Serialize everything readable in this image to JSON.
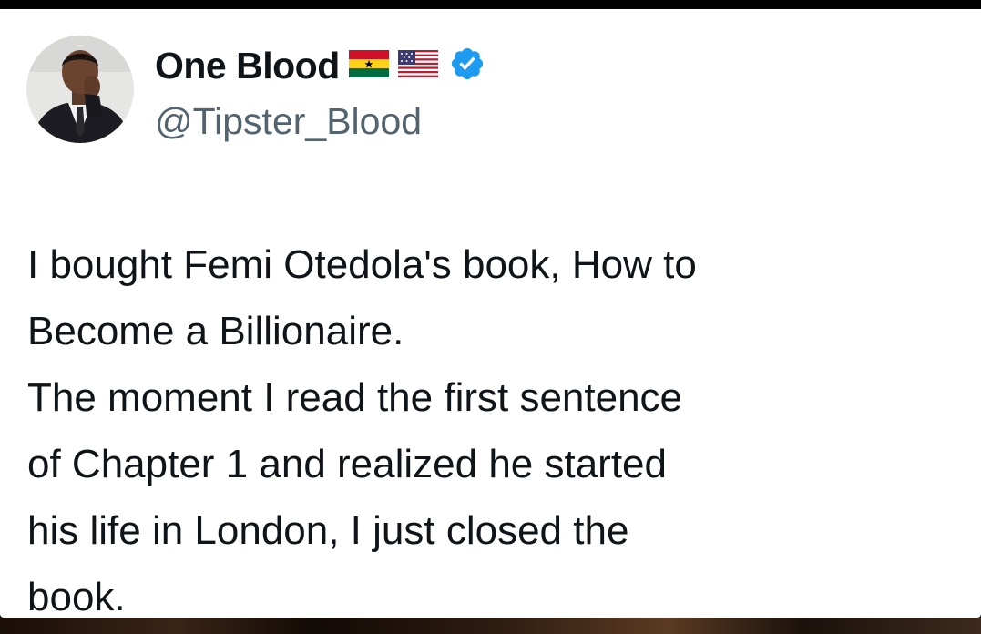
{
  "tweet": {
    "author": {
      "display_name": "One Blood",
      "handle": "@Tipster_Blood",
      "badges": [
        "ghana-flag-icon",
        "usa-flag-icon",
        "verified-badge-icon"
      ],
      "verified_color": "#1d9bf0"
    },
    "text_lines": [
      "I bought Femi Otedola's book, How to",
      "Become a Billionaire.",
      "The moment I read the first sentence",
      "of Chapter 1 and realized he started",
      "his life in London, I just closed the",
      "book."
    ]
  }
}
